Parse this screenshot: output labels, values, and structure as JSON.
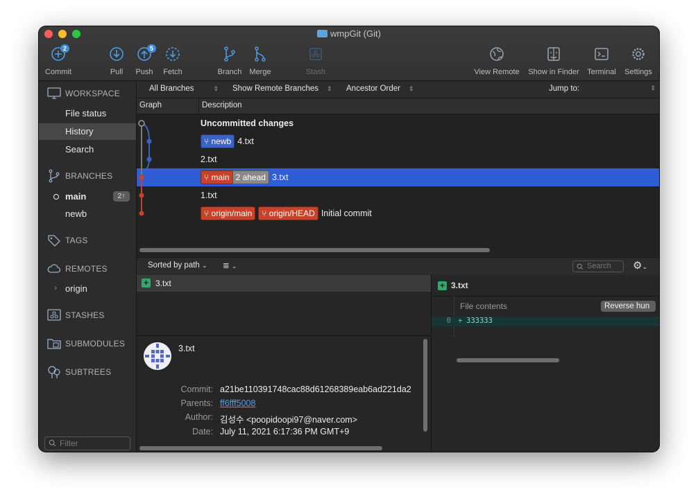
{
  "window": {
    "title": "wmpGit (Git)"
  },
  "toolbar": {
    "commit": {
      "label": "Commit",
      "badge": "2"
    },
    "pull": {
      "label": "Pull"
    },
    "push": {
      "label": "Push",
      "badge": "5"
    },
    "fetch": {
      "label": "Fetch"
    },
    "branch": {
      "label": "Branch"
    },
    "merge": {
      "label": "Merge"
    },
    "stash": {
      "label": "Stash"
    },
    "view_remote": {
      "label": "View Remote"
    },
    "show_in_finder": {
      "label": "Show in Finder"
    },
    "terminal": {
      "label": "Terminal"
    },
    "settings": {
      "label": "Settings"
    }
  },
  "sidebar": {
    "workspace": {
      "title": "WORKSPACE",
      "items": [
        "File status",
        "History",
        "Search"
      ]
    },
    "branches": {
      "title": "BRANCHES",
      "items": [
        {
          "name": "main",
          "badge": "2↑"
        },
        {
          "name": "newb"
        }
      ]
    },
    "tags": {
      "title": "TAGS"
    },
    "remotes": {
      "title": "REMOTES",
      "items": [
        "origin"
      ]
    },
    "stashes": {
      "title": "STASHES"
    },
    "submodules": {
      "title": "SUBMODULES"
    },
    "subtrees": {
      "title": "SUBTREES"
    },
    "filter_placeholder": "Filter"
  },
  "graph_filters": {
    "branches": "All Branches",
    "remote": "Show Remote Branches",
    "order": "Ancestor Order",
    "jump": "Jump to:"
  },
  "columns": {
    "graph": "Graph",
    "description": "Description"
  },
  "commits": [
    {
      "desc": "Uncommitted changes"
    },
    {
      "tag": "newb",
      "desc": "4.txt"
    },
    {
      "desc": "2.txt"
    },
    {
      "tag": "main",
      "ahead": "2 ahead",
      "desc": "3.txt"
    },
    {
      "desc": "1.txt"
    },
    {
      "tag1": "origin/main",
      "tag2": "origin/HEAD",
      "desc": "Initial commit"
    }
  ],
  "files": {
    "sort": "Sorted by path",
    "search_placeholder": "Search",
    "items": [
      "3.txt"
    ]
  },
  "commit_details": {
    "title": "3.txt",
    "commit_label": "Commit:",
    "commit": "a21be110391748cac88d61268389eab6ad221da2",
    "parents_label": "Parents:",
    "parents": "ff6fff5008",
    "author_label": "Author:",
    "author": "김성수 <poopidoopi97@naver.com>",
    "date_label": "Date:",
    "date": "July 11, 2021 6:17:36 PM GMT+9"
  },
  "diff": {
    "file": "3.txt",
    "hunk_header": "File contents",
    "reverse_button": "Reverse hun",
    "line_no": "0",
    "line_marker": "+",
    "line_text": "333333"
  },
  "colors": {
    "selection": "#2f5ed4",
    "branch_blue": "#3a63c4",
    "branch_red": "#c8412b",
    "added": "#38a36a"
  }
}
